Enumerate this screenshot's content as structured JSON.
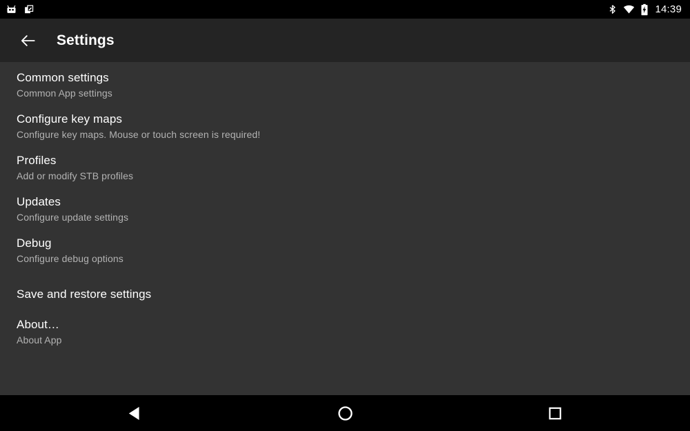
{
  "status_bar": {
    "notification_icons": [
      "robot-app-icon",
      "clipboard-edit-icon"
    ],
    "system_icons": [
      "bluetooth-icon",
      "wifi-icon",
      "battery-charging-icon"
    ],
    "clock": "14:39",
    "background_color": "#000000",
    "icon_color": "#ffffff"
  },
  "app_bar": {
    "back_icon": "back-arrow-icon",
    "title": "Settings",
    "background_color": "#242424",
    "text_color": "#ffffff"
  },
  "content": {
    "background_color": "#333333",
    "title_color": "#ffffff",
    "summary_color": "#b3b3b3",
    "items": [
      {
        "title": "Common settings",
        "summary": "Common App settings"
      },
      {
        "title": "Configure key maps",
        "summary": "Configure key maps. Mouse or touch screen is required!"
      },
      {
        "title": "Profiles",
        "summary": "Add or modify STB profiles"
      },
      {
        "title": "Updates",
        "summary": "Configure update settings"
      },
      {
        "title": "Debug",
        "summary": "Configure debug options"
      },
      {
        "title": "Save and restore settings",
        "summary": ""
      },
      {
        "title": "About…",
        "summary": "About App"
      }
    ]
  },
  "nav_bar": {
    "background_color": "#000000",
    "icon_color": "#ffffff",
    "buttons": [
      {
        "name": "back-nav-icon",
        "label": "Back"
      },
      {
        "name": "home-nav-icon",
        "label": "Home"
      },
      {
        "name": "recents-nav-icon",
        "label": "Recent apps"
      }
    ]
  }
}
